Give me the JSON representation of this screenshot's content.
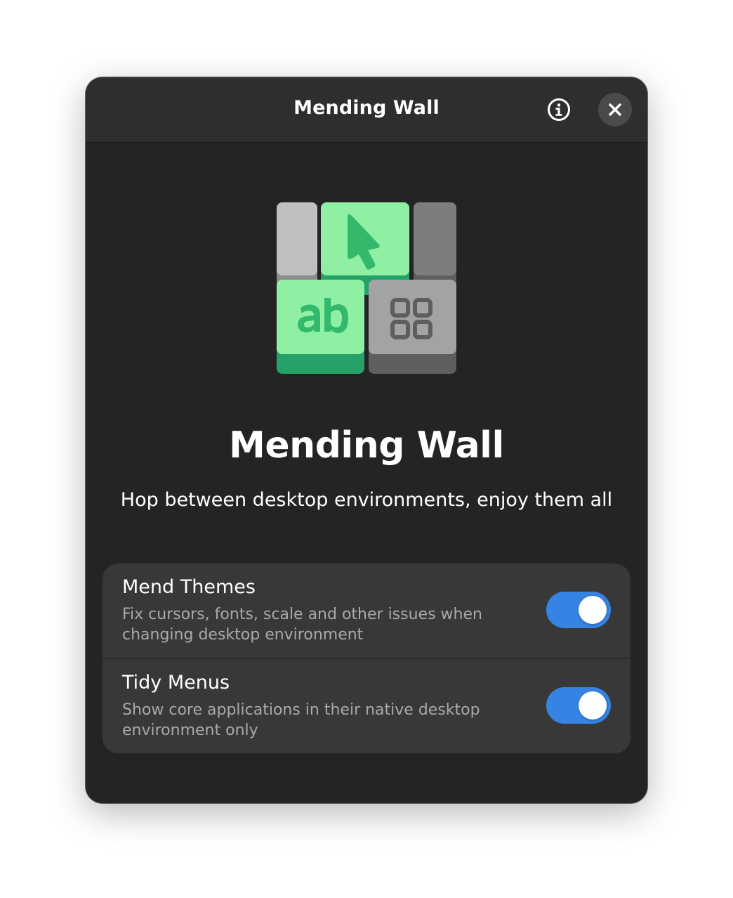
{
  "window": {
    "title": "Mending Wall"
  },
  "header": {
    "about_icon": "info-icon",
    "close_icon": "close-icon"
  },
  "app": {
    "icon": "mending-wall-app-icon",
    "name": "Mending Wall",
    "description": "Hop between desktop environments, enjoy them all"
  },
  "settings": [
    {
      "title": "Mend Themes",
      "subtitle": "Fix cursors, fonts, scale and other issues when changing desktop environment",
      "enabled": true
    },
    {
      "title": "Tidy Menus",
      "subtitle": "Show core applications in their native desktop environment only",
      "enabled": true
    }
  ],
  "colors": {
    "accent": "#3584e4",
    "window_bg": "#242424",
    "headerbar_bg": "#2e2e2e",
    "card_bg": "#383838",
    "icon_green_light": "#8ff0a4",
    "icon_green_dark": "#26a269",
    "icon_gray": "#a0a0a0"
  }
}
